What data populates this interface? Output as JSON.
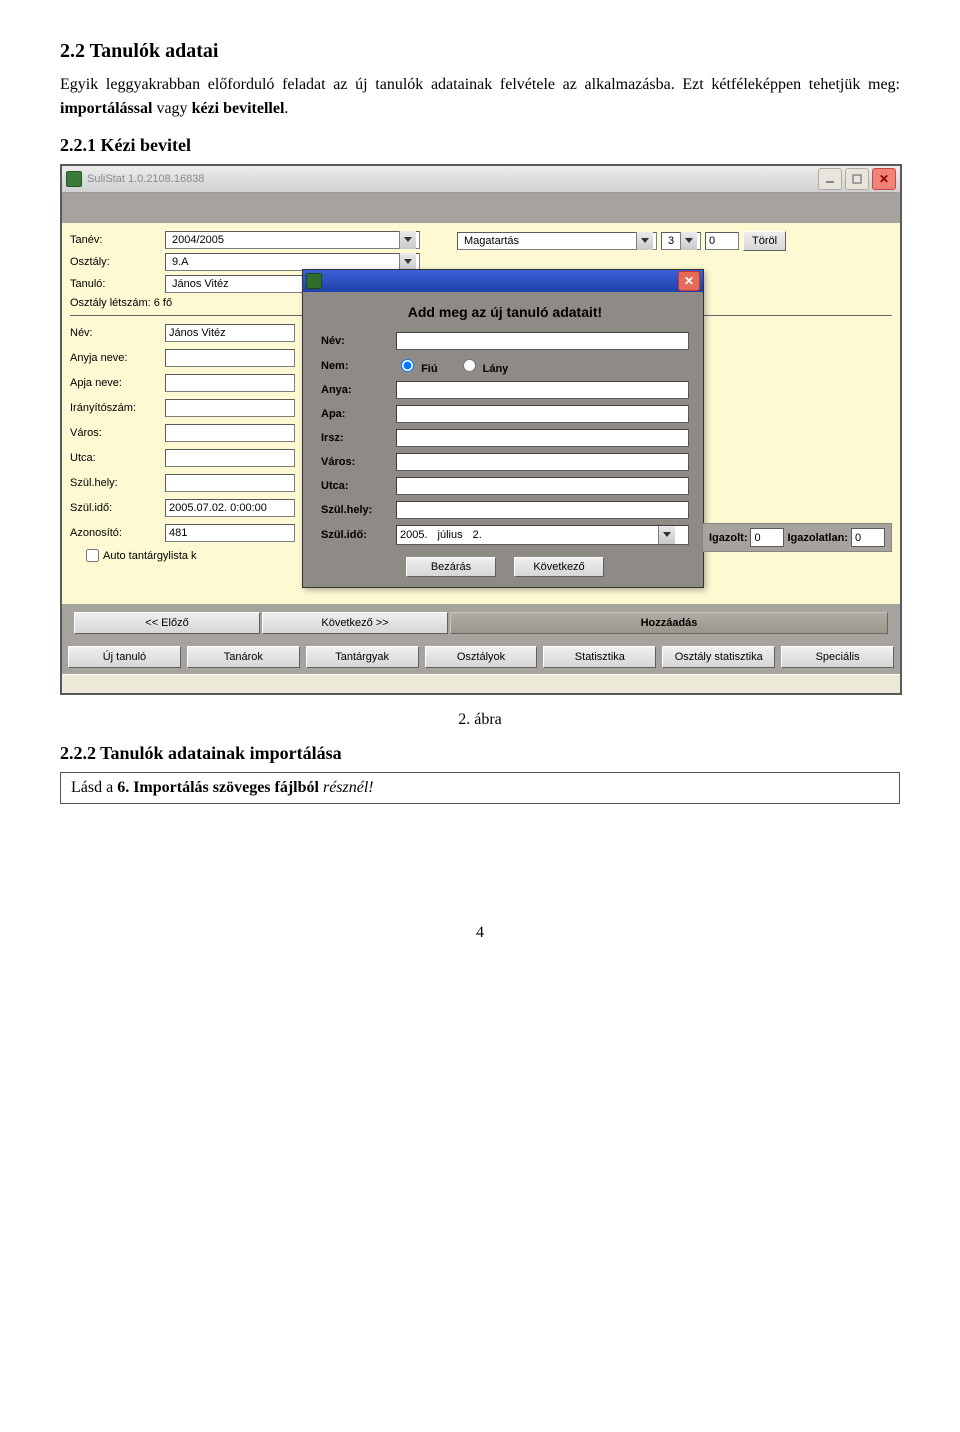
{
  "doc": {
    "h2": "2.2  Tanulók adatai",
    "p1": "Egyik leggyakrabban előforduló feladat az új tanulók adatainak felvétele az alkalmazásba. Ezt kétféleképpen tehetjük meg: importálással vagy kézi bevitellel.",
    "p1_bold1": "importálással",
    "p1_bold2": "kézi bevitellel",
    "h3a": "2.2.1  Kézi bevitel",
    "fig_caption": "2. ábra",
    "h3b": "2.2.2  Tanulók adatainak importálása",
    "note_prefix": "Lásd a ",
    "note_bold": "6. Importálás szöveges fájlból",
    "note_suffix": " résznél!",
    "page": "4"
  },
  "win": {
    "title": "SuliStat 1.0.2108.16838",
    "top_labels": {
      "tanev": "Tanév:",
      "osztaly": "Osztály:",
      "tanulo": "Tanuló:",
      "letszam_label": "Osztály létszám: 6 fő"
    },
    "top_values": {
      "tanev": "2004/2005",
      "osztaly": "9.A",
      "tanulo": "János Vitéz"
    },
    "top_right": {
      "subject": "Magatartás",
      "grade": "3",
      "weight": "0",
      "delete": "Töröl"
    },
    "details": {
      "nev_l": "Név:",
      "nev_v": "János Vitéz",
      "anyja_l": "Anyja neve:",
      "apja_l": "Apja neve:",
      "irsz_l": "Irányítószám:",
      "varos_l": "Város:",
      "utca_l": "Utca:",
      "szhely_l": "Szül.hely:",
      "szido_l": "Szül.idő:",
      "szido_v": "2005.07.02. 0:00:00",
      "azon_l": "Azonosító:",
      "azon_v": "481",
      "auto": "Auto tantárgylista k"
    },
    "nav": {
      "prev": "<< Előző",
      "next": "Következő >>",
      "add": "Hozzáadás"
    },
    "tabs": [
      "Új tanuló",
      "Tanárok",
      "Tantárgyak",
      "Osztályok",
      "Statisztika",
      "Osztály statisztika",
      "Speciális"
    ],
    "igazolt": {
      "ig_l": "Igazolt:",
      "ig_v": "0",
      "igl_l": "Igazolatlan:",
      "igl_v": "0"
    }
  },
  "dlg": {
    "heading": "Add meg az új tanuló adatait!",
    "labels": {
      "nev": "Név:",
      "nem": "Nem:",
      "anya": "Anya:",
      "apa": "Apa:",
      "irsz": "Irsz:",
      "varos": "Város:",
      "utca": "Utca:",
      "szhely": "Szül.hely:",
      "szido": "Szül.idő:"
    },
    "gender": {
      "fiu": "Fiú",
      "lany": "Lány"
    },
    "date": {
      "year": "2005.",
      "month": "július",
      "day": "2."
    },
    "buttons": {
      "close": "Bezárás",
      "next": "Következő"
    }
  }
}
